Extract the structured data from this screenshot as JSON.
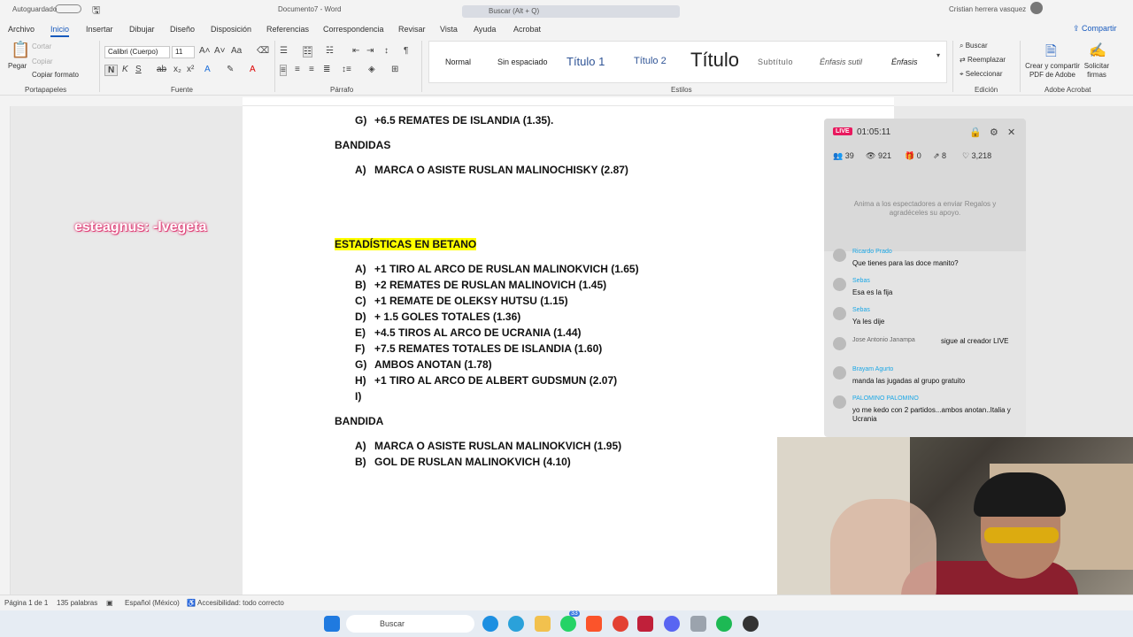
{
  "titlebar": {
    "autosave": "Autoguardado",
    "doc_title": "Documento7 - Word",
    "search_placeholder": "Buscar (Alt + Q)",
    "user_name": "Cristian herrera vasquez"
  },
  "tabs": [
    "Archivo",
    "Inicio",
    "Insertar",
    "Dibujar",
    "Diseño",
    "Disposición",
    "Referencias",
    "Correspondencia",
    "Revisar",
    "Vista",
    "Ayuda",
    "Acrobat"
  ],
  "share_label": "Compartir",
  "clipboard": {
    "paste": "Pegar",
    "cut": "Cortar",
    "copy": "Copiar",
    "format_painter": "Copiar formato",
    "label": "Portapapeles"
  },
  "font": {
    "name": "Calibri (Cuerpo)",
    "size": "11",
    "label": "Fuente",
    "bold": "N",
    "italic": "K",
    "underline": "S"
  },
  "paragraph": {
    "label": "Párrafo"
  },
  "styles": {
    "label": "Estilos",
    "items": [
      "Normal",
      "Sin espaciado",
      "Título 1",
      "Título 2",
      "Título",
      "Subtítulo",
      "Énfasis sutil",
      "Énfasis"
    ]
  },
  "editing": {
    "find": "Buscar",
    "replace": "Reemplazar",
    "select": "Seleccionar",
    "label": "Edición"
  },
  "acrobat": {
    "create_share": "Crear y compartir PDF de Adobe",
    "request_sign": "Solicitar firmas",
    "label": "Adobe Acrobat"
  },
  "document": {
    "top_line_partial": "G)",
    "top_line_g": "+6.5 REMATES DE ISLANDIA (1.35).",
    "section1": "BANDIDAS",
    "section1_items": [
      {
        "letter": "A)",
        "text": "MARCA O ASISTE RUSLAN MALINOCHISKY (2.87)"
      }
    ],
    "section2": "ESTADÍSTICAS EN BETANO",
    "section2_items": [
      {
        "letter": "A)",
        "text": "+1 TIRO AL ARCO DE RUSLAN MALINOKVICH (1.65)"
      },
      {
        "letter": "B)",
        "text": "+2 REMATES DE RUSLAN MALINOVICH (1.45)"
      },
      {
        "letter": "C)",
        "text": "+1 REMATE DE OLEKSY HUTSU (1.15)"
      },
      {
        "letter": "D)",
        "text": "+ 1.5 GOLES TOTALES (1.36)"
      },
      {
        "letter": "E)",
        "text": "+4.5 TIROS AL ARCO DE UCRANIA (1.44)"
      },
      {
        "letter": "F)",
        "text": "+7.5 REMATES TOTALES DE ISLANDIA (1.60)"
      },
      {
        "letter": "G)",
        "text": "AMBOS ANOTAN (1.78)"
      },
      {
        "letter": "H)",
        "text": "+1 TIRO AL ARCO DE ALBERT GUDSMUN (2.07)"
      },
      {
        "letter": "I)",
        "text": ""
      }
    ],
    "section3": "BANDIDA",
    "section3_items": [
      {
        "letter": "A)",
        "text": "MARCA O ASISTE RUSLAN MALINOKVICH (1.95)"
      },
      {
        "letter": "B)",
        "text": "GOL DE RUSLAN MALINOKVICH (4.10)"
      }
    ]
  },
  "overlay_user": "esteagnus: -Ivegeta",
  "status": {
    "page": "Página 1 de 1",
    "words": "135 palabras",
    "language": "Español (México)",
    "accessibility": "Accesibilidad: todo correcto"
  },
  "taskbar": {
    "search": "Buscar",
    "whatsapp_badge": "33"
  },
  "live": {
    "badge": "LIVE",
    "time": "01:05:11",
    "stats": {
      "viewers_now": "39",
      "views": "921",
      "gifts": "0",
      "shares": "8",
      "likes": "3,218"
    },
    "invite": "Anima a los espectadores a enviar Regalos y agradéceles su apoyo.",
    "chat": [
      {
        "name": "Ricardo Prado",
        "text": "Que tienes para las doce manito?"
      },
      {
        "name": "Sebas",
        "text": "Esa es la fija"
      },
      {
        "name": "Sebas",
        "text": "Ya les dije"
      },
      {
        "name": "Jose Antonio Janampa",
        "text": "sigue al creador LIVE"
      },
      {
        "name": "Brayam Agurto",
        "text": "manda las jugadas al grupo gratuito"
      },
      {
        "name": "PALOMINO PALOMINO",
        "text": "yo me kedo con 2 partidos...ambos anotan..Italia y Ucrania"
      }
    ]
  },
  "colors": {
    "accent": "#185abd",
    "highlight": "#ffff00",
    "live_pink": "#e8195e",
    "chat_name": "#1aa7e6"
  }
}
